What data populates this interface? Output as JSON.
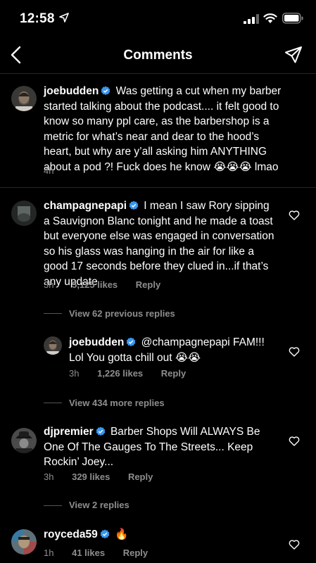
{
  "status_bar": {
    "time": "12:58"
  },
  "nav": {
    "title": "Comments"
  },
  "caption": {
    "username": "joebudden",
    "text": "Was getting a cut when my barber started talking about the podcast.... it felt good to know so many ppl care, as the barbershop is a metric for what’s near and dear to the hood’s heart, but why are y’all asking him ANYTHING about a pod ?! Fuck does he know 😭😭😭 lmao",
    "time": "4h"
  },
  "comments": [
    {
      "username": "champagnepapi",
      "text": "I mean I saw Rory sipping a Sauvignon Blanc tonight and he made a toast but everyone else was engaged in conversation so his glass was hanging in the air for like a good 17 seconds before they clued in...if that’s any update",
      "time": "3h",
      "likes": "5,125 likes",
      "reply": "Reply",
      "view_replies": "View 62 previous replies"
    },
    {
      "username": "joebudden",
      "text": "@champagnepapi FAM!!! Lol You gotta chill out 😭😭",
      "time": "3h",
      "likes": "1,226 likes",
      "reply": "Reply",
      "view_replies": "View 434 more replies"
    },
    {
      "username": "djpremier",
      "text": "Barber Shops Will ALWAYS Be One Of The Gauges To The Streets... Keep Rockin’ Joey...",
      "time": "3h",
      "likes": "329 likes",
      "reply": "Reply",
      "view_replies": "View 2 replies"
    },
    {
      "username": "royceda59",
      "text": "🔥",
      "time": "1h",
      "likes": "41 likes",
      "reply": "Reply"
    }
  ],
  "colors": {
    "background": "#000000",
    "text": "#ffffff",
    "secondary": "#8e8e8e",
    "verified": "#3897f0"
  }
}
